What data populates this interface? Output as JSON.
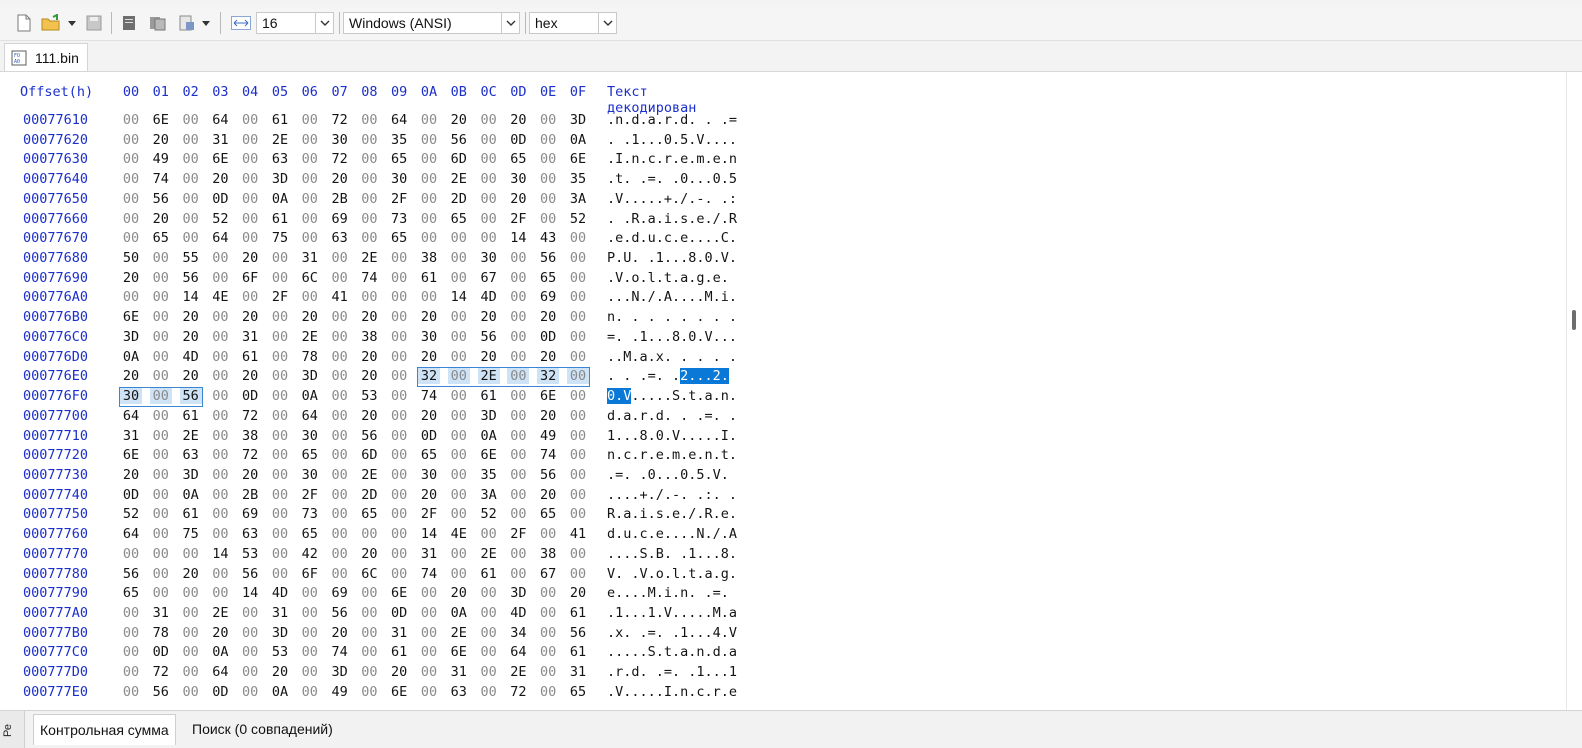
{
  "toolbar": {
    "bytes_per_row": "16",
    "encoding": "Windows (ANSI)",
    "format": "hex"
  },
  "tabs": {
    "file": "111.bin"
  },
  "hexview": {
    "header": {
      "offset_label": "Offset(h)",
      "columns": [
        "00",
        "01",
        "02",
        "03",
        "04",
        "05",
        "06",
        "07",
        "08",
        "09",
        "0A",
        "0B",
        "0C",
        "0D",
        "0E",
        "0F"
      ],
      "text_label": "Текст декодирован"
    },
    "rows": [
      {
        "offset": "00077610",
        "bytes": [
          "00",
          "6E",
          "00",
          "64",
          "00",
          "61",
          "00",
          "72",
          "00",
          "64",
          "00",
          "20",
          "00",
          "20",
          "00",
          "3D"
        ],
        "text": ".n.d.a.r.d. . .="
      },
      {
        "offset": "00077620",
        "bytes": [
          "00",
          "20",
          "00",
          "31",
          "00",
          "2E",
          "00",
          "30",
          "00",
          "35",
          "00",
          "56",
          "00",
          "0D",
          "00",
          "0A"
        ],
        "text": ". .1...0.5.V...."
      },
      {
        "offset": "00077630",
        "bytes": [
          "00",
          "49",
          "00",
          "6E",
          "00",
          "63",
          "00",
          "72",
          "00",
          "65",
          "00",
          "6D",
          "00",
          "65",
          "00",
          "6E"
        ],
        "text": ".I.n.c.r.e.m.e.n"
      },
      {
        "offset": "00077640",
        "bytes": [
          "00",
          "74",
          "00",
          "20",
          "00",
          "3D",
          "00",
          "20",
          "00",
          "30",
          "00",
          "2E",
          "00",
          "30",
          "00",
          "35"
        ],
        "text": ".t. .=. .0...0.5"
      },
      {
        "offset": "00077650",
        "bytes": [
          "00",
          "56",
          "00",
          "0D",
          "00",
          "0A",
          "00",
          "2B",
          "00",
          "2F",
          "00",
          "2D",
          "00",
          "20",
          "00",
          "3A"
        ],
        "text": ".V.....+./.-. .:"
      },
      {
        "offset": "00077660",
        "bytes": [
          "00",
          "20",
          "00",
          "52",
          "00",
          "61",
          "00",
          "69",
          "00",
          "73",
          "00",
          "65",
          "00",
          "2F",
          "00",
          "52"
        ],
        "text": ". .R.a.i.s.e./.R"
      },
      {
        "offset": "00077670",
        "bytes": [
          "00",
          "65",
          "00",
          "64",
          "00",
          "75",
          "00",
          "63",
          "00",
          "65",
          "00",
          "00",
          "00",
          "14",
          "43",
          "00"
        ],
        "text": ".e.d.u.c.e....C."
      },
      {
        "offset": "00077680",
        "bytes": [
          "50",
          "00",
          "55",
          "00",
          "20",
          "00",
          "31",
          "00",
          "2E",
          "00",
          "38",
          "00",
          "30",
          "00",
          "56",
          "00"
        ],
        "text": "P.U. .1...8.0.V."
      },
      {
        "offset": "00077690",
        "bytes": [
          "20",
          "00",
          "56",
          "00",
          "6F",
          "00",
          "6C",
          "00",
          "74",
          "00",
          "61",
          "00",
          "67",
          "00",
          "65",
          "00"
        ],
        "text": " .V.o.l.t.a.g.e."
      },
      {
        "offset": "000776A0",
        "bytes": [
          "00",
          "00",
          "14",
          "4E",
          "00",
          "2F",
          "00",
          "41",
          "00",
          "00",
          "00",
          "14",
          "4D",
          "00",
          "69",
          "00"
        ],
        "text": "...N./.A....M.i."
      },
      {
        "offset": "000776B0",
        "bytes": [
          "6E",
          "00",
          "20",
          "00",
          "20",
          "00",
          "20",
          "00",
          "20",
          "00",
          "20",
          "00",
          "20",
          "00",
          "20",
          "00"
        ],
        "text": "n. . . . . . . ."
      },
      {
        "offset": "000776C0",
        "bytes": [
          "3D",
          "00",
          "20",
          "00",
          "31",
          "00",
          "2E",
          "00",
          "38",
          "00",
          "30",
          "00",
          "56",
          "00",
          "0D",
          "00"
        ],
        "text": "=. .1...8.0.V..."
      },
      {
        "offset": "000776D0",
        "bytes": [
          "0A",
          "00",
          "4D",
          "00",
          "61",
          "00",
          "78",
          "00",
          "20",
          "00",
          "20",
          "00",
          "20",
          "00",
          "20",
          "00"
        ],
        "text": "..M.a.x. . . . ."
      },
      {
        "offset": "000776E0",
        "bytes": [
          "20",
          "00",
          "20",
          "00",
          "20",
          "00",
          "3D",
          "00",
          "20",
          "00",
          "32",
          "00",
          "2E",
          "00",
          "32",
          "00"
        ],
        "text_pre": " . . .=. .",
        "text_sel": "2...2.",
        "text_post": ""
      },
      {
        "offset": "000776F0",
        "bytes": [
          "30",
          "00",
          "56",
          "00",
          "0D",
          "00",
          "0A",
          "00",
          "53",
          "00",
          "74",
          "00",
          "61",
          "00",
          "6E",
          "00"
        ],
        "text_pre": "",
        "text_sel": "0.V",
        "text_post": ".....S.t.a.n."
      },
      {
        "offset": "00077700",
        "bytes": [
          "64",
          "00",
          "61",
          "00",
          "72",
          "00",
          "64",
          "00",
          "20",
          "00",
          "20",
          "00",
          "3D",
          "00",
          "20",
          "00"
        ],
        "text": "d.a.r.d. . .=. ."
      },
      {
        "offset": "00077710",
        "bytes": [
          "31",
          "00",
          "2E",
          "00",
          "38",
          "00",
          "30",
          "00",
          "56",
          "00",
          "0D",
          "00",
          "0A",
          "00",
          "49",
          "00"
        ],
        "text": "1...8.0.V.....I."
      },
      {
        "offset": "00077720",
        "bytes": [
          "6E",
          "00",
          "63",
          "00",
          "72",
          "00",
          "65",
          "00",
          "6D",
          "00",
          "65",
          "00",
          "6E",
          "00",
          "74",
          "00"
        ],
        "text": "n.c.r.e.m.e.n.t."
      },
      {
        "offset": "00077730",
        "bytes": [
          "20",
          "00",
          "3D",
          "00",
          "20",
          "00",
          "30",
          "00",
          "2E",
          "00",
          "30",
          "00",
          "35",
          "00",
          "56",
          "00"
        ],
        "text": " .=. .0...0.5.V."
      },
      {
        "offset": "00077740",
        "bytes": [
          "0D",
          "00",
          "0A",
          "00",
          "2B",
          "00",
          "2F",
          "00",
          "2D",
          "00",
          "20",
          "00",
          "3A",
          "00",
          "20",
          "00"
        ],
        "text": "....+./.-. .:. ."
      },
      {
        "offset": "00077750",
        "bytes": [
          "52",
          "00",
          "61",
          "00",
          "69",
          "00",
          "73",
          "00",
          "65",
          "00",
          "2F",
          "00",
          "52",
          "00",
          "65",
          "00"
        ],
        "text": "R.a.i.s.e./.R.e."
      },
      {
        "offset": "00077760",
        "bytes": [
          "64",
          "00",
          "75",
          "00",
          "63",
          "00",
          "65",
          "00",
          "00",
          "00",
          "14",
          "4E",
          "00",
          "2F",
          "00",
          "41"
        ],
        "text": "d.u.c.e....N./.A"
      },
      {
        "offset": "00077770",
        "bytes": [
          "00",
          "00",
          "00",
          "14",
          "53",
          "00",
          "42",
          "00",
          "20",
          "00",
          "31",
          "00",
          "2E",
          "00",
          "38",
          "00"
        ],
        "text": "....S.B. .1...8."
      },
      {
        "offset": "00077780",
        "bytes": [
          "56",
          "00",
          "20",
          "00",
          "56",
          "00",
          "6F",
          "00",
          "6C",
          "00",
          "74",
          "00",
          "61",
          "00",
          "67",
          "00"
        ],
        "text": "V. .V.o.l.t.a.g."
      },
      {
        "offset": "00077790",
        "bytes": [
          "65",
          "00",
          "00",
          "00",
          "14",
          "4D",
          "00",
          "69",
          "00",
          "6E",
          "00",
          "20",
          "00",
          "3D",
          "00",
          "20"
        ],
        "text": "e....M.i.n. .=. "
      },
      {
        "offset": "000777A0",
        "bytes": [
          "00",
          "31",
          "00",
          "2E",
          "00",
          "31",
          "00",
          "56",
          "00",
          "0D",
          "00",
          "0A",
          "00",
          "4D",
          "00",
          "61"
        ],
        "text": ".1...1.V.....M.a"
      },
      {
        "offset": "000777B0",
        "bytes": [
          "00",
          "78",
          "00",
          "20",
          "00",
          "3D",
          "00",
          "20",
          "00",
          "31",
          "00",
          "2E",
          "00",
          "34",
          "00",
          "56"
        ],
        "text": ".x. .=. .1...4.V"
      },
      {
        "offset": "000777C0",
        "bytes": [
          "00",
          "0D",
          "00",
          "0A",
          "00",
          "53",
          "00",
          "74",
          "00",
          "61",
          "00",
          "6E",
          "00",
          "64",
          "00",
          "61"
        ],
        "text": ".....S.t.a.n.d.a"
      },
      {
        "offset": "000777D0",
        "bytes": [
          "00",
          "72",
          "00",
          "64",
          "00",
          "20",
          "00",
          "3D",
          "00",
          "20",
          "00",
          "31",
          "00",
          "2E",
          "00",
          "31"
        ],
        "text": ".r.d. .=. .1...1"
      },
      {
        "offset": "000777E0",
        "bytes": [
          "00",
          "56",
          "00",
          "0D",
          "00",
          "0A",
          "00",
          "49",
          "00",
          "6E",
          "00",
          "63",
          "00",
          "72",
          "00",
          "65"
        ],
        "text": ".V.....I.n.c.r.e"
      }
    ]
  },
  "bottom_panel": {
    "side_tab": "Ре",
    "tabs": [
      "Контрольная сумма",
      "Поиск (0 совпадений)"
    ]
  }
}
